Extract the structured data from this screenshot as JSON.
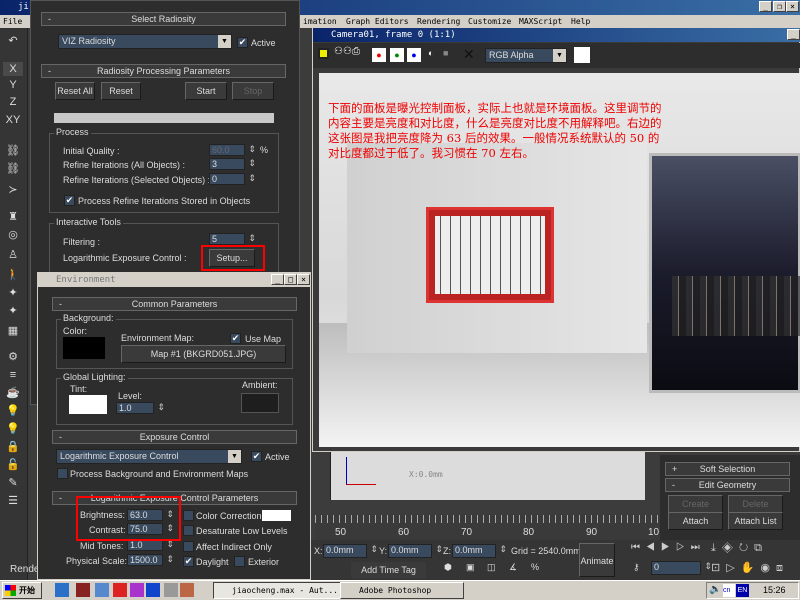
{
  "main_window": {
    "title": "ji",
    "menu_file": "File",
    "menu_items": [
      "imation",
      "Graph Editors",
      "Rendering",
      "Customize",
      "MAXScript",
      "Help"
    ]
  },
  "left_toolbar": {
    "items": [
      "undo-icon",
      "X",
      "Y",
      "Z",
      "XY",
      "select-link-icon",
      "unlink-icon",
      "bind-icon",
      "hierarchy-icon",
      "motion-icon",
      "figure-icon",
      "walk-icon",
      "bone-icon",
      "bone2-icon",
      "render-icon",
      "ik-icon",
      "layer-icon",
      "layer2-icon",
      "light-icon",
      "light2-icon",
      "lock-icon",
      "unlock-icon",
      "render-setup-icon",
      "layers-icon"
    ],
    "render_label": "Rende"
  },
  "radiosity": {
    "select_title": "Select Radiosity",
    "engine": "VIZ Radiosity",
    "active_label": "Active",
    "active": true,
    "proc_title": "Radiosity Processing Parameters",
    "reset_all": "Reset All",
    "reset": "Reset",
    "start": "Start",
    "stop": "Stop",
    "process_title": "Process",
    "initial_quality_label": "Initial Quality :",
    "initial_quality": "60.0",
    "percent": "%",
    "refine_all_label": "Refine Iterations (All Objects) :",
    "refine_all": "3",
    "refine_sel_label": "Refine Iterations (Selected Objects) :",
    "refine_sel": "0",
    "process_stored_label": "Process Refine Iterations Stored in Objects",
    "process_stored": true,
    "interactive_title": "Interactive Tools",
    "filtering_label": "Filtering :",
    "filtering": "5",
    "log_exposure_label": "Logarithmic Exposure Control :",
    "setup": "Setup..."
  },
  "environment": {
    "title": "Environment",
    "common_title": "Common Parameters",
    "background_label": "Background:",
    "color_label": "Color:",
    "env_map_label": "Environment Map:",
    "use_map_label": "Use Map",
    "use_map": true,
    "map_button": "Map #1 (BKGRD051.JPG)",
    "global_lighting_label": "Global Lighting:",
    "tint_label": "Tint:",
    "level_label": "Level:",
    "level": "1.0",
    "ambient_label": "Ambient:",
    "exposure_title": "Exposure Control",
    "exposure_type": "Logarithmic Exposure Control",
    "exposure_active_label": "Active",
    "exposure_active": true,
    "process_bg_label": "Process Background and Environment Maps",
    "log_title": "Logarithmic Exposure Control Parameters",
    "brightness_label": "Brightness:",
    "brightness": "63.0",
    "contrast_label": "Contrast:",
    "contrast": "75.0",
    "mid_tones_label": "Mid Tones:",
    "mid_tones": "1.0",
    "physical_scale_label": "Physical Scale:",
    "physical_scale": "1500.0",
    "color_correction_label": "Color Correction:",
    "desaturate_label": "Desaturate Low Levels",
    "affect_indirect_label": "Affect Indirect Only",
    "daylight_label": "Daylight",
    "daylight": true,
    "exterior_label": "Exterior",
    "colors": {
      "background": "#000000",
      "tint": "#ffffff",
      "ambient": "#1e1e1e",
      "color_correction": "#ffffff"
    }
  },
  "render_window": {
    "title": "Camera01, frame 0 (1:1)",
    "channel": "RGB Alpha",
    "annotation": "下面的面板是曝光控制面板，实际上也就是环境面板。这里调节的内容主要是亮度和对比度，什么是亮度对比度不用解释吧。右边的这张图是我把亮度降为 63 后的效果。一般情况系统默认的 50 的对比度都过于低了。我习惯在 70 左右。"
  },
  "viewport": {
    "coord_readout": "X:0.0mm"
  },
  "command_panel": {
    "soft_selection": "Soft Selection",
    "edit_geometry": "Edit Geometry",
    "create": "Create",
    "delete": "Delete",
    "attach": "Attach",
    "attach_list": "Attach List"
  },
  "timeline": {
    "ticks": [
      "50",
      "60",
      "70",
      "80",
      "90",
      "10"
    ]
  },
  "status": {
    "x_label": "X:",
    "x": "0.0mm",
    "y_label": "Y:",
    "y": "0.0mm",
    "z_label": "Z:",
    "z": "0.0mm",
    "grid": "Grid = 2540.0mm",
    "animate": "Animate",
    "add_time_tag": "Add Time Tag",
    "frame": "0"
  },
  "taskbar": {
    "start": "开始",
    "tasks": [
      "jiaocheng.max - Aut...",
      "Adobe Photoshop"
    ],
    "ime": "EN",
    "clock": "15:26"
  }
}
